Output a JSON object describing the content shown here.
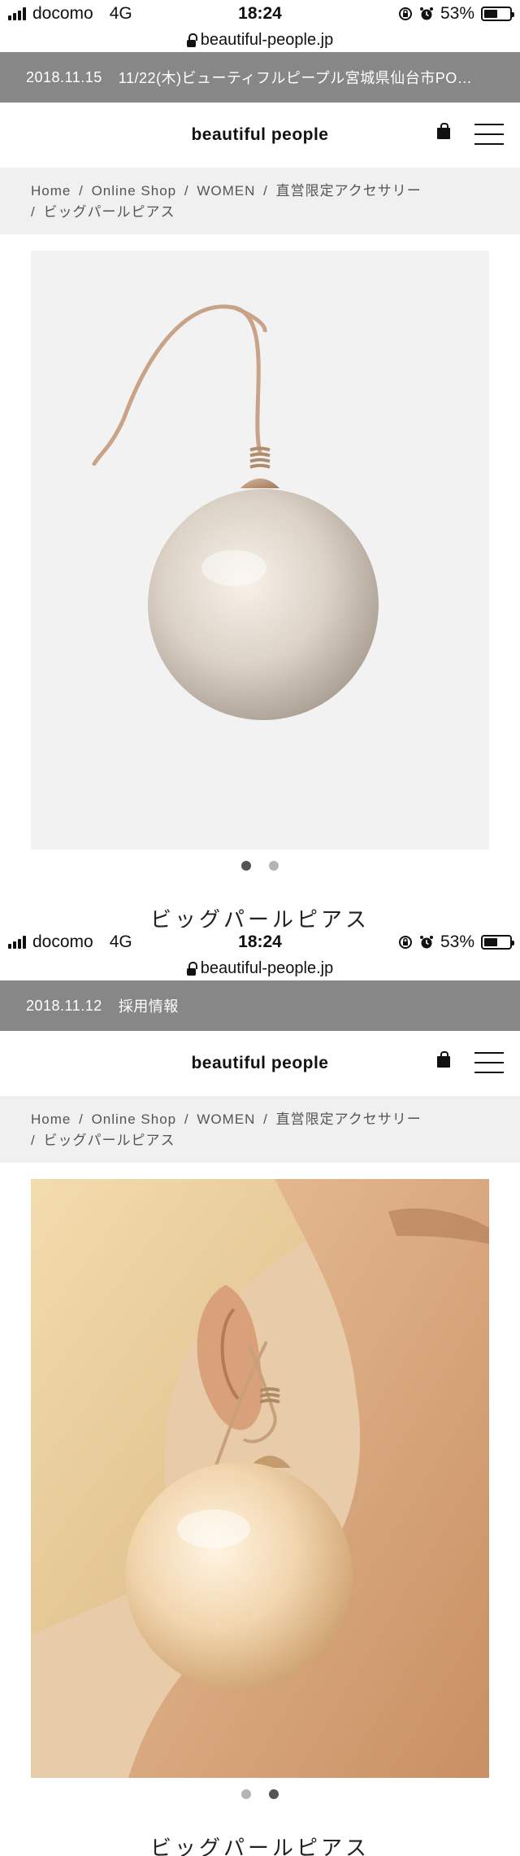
{
  "screens": [
    {
      "status": {
        "carrier": "docomo",
        "network": "4G",
        "time": "18:24",
        "battery": "53%",
        "battery_level": 0.53
      },
      "url": "beautiful-people.jp",
      "ticker": {
        "date": "2018.11.15",
        "text": "11/22(木)ビューティフルピープル宮城県仙台市PO…"
      },
      "logo": "beautiful people",
      "breadcrumb": {
        "home": "Home",
        "shop": "Online Shop",
        "women": "WOMEN",
        "category": "直営限定アクセサリー",
        "current": "ビッグパールピアス",
        "sep": "/"
      },
      "active_slide": 1,
      "product_title": "ビッグパールピアス"
    },
    {
      "status": {
        "carrier": "docomo",
        "network": "4G",
        "time": "18:24",
        "battery": "53%",
        "battery_level": 0.53
      },
      "url": "beautiful-people.jp",
      "ticker": {
        "date": "2018.11.12",
        "text": "採用情報"
      },
      "logo": "beautiful people",
      "breadcrumb": {
        "home": "Home",
        "shop": "Online Shop",
        "women": "WOMEN",
        "category": "直営限定アクセサリー",
        "current": "ビッグパールピアス",
        "sep": "/"
      },
      "active_slide": 2,
      "product_title": "ビッグパールピアス"
    }
  ],
  "icons": {
    "bag": "shopping-bag-icon",
    "menu": "hamburger-menu-icon",
    "lock": "lock-icon",
    "alarm": "alarm-clock-icon",
    "rotation": "rotation-lock-icon"
  },
  "colors": {
    "ticker_bg": "#878787",
    "breadcrumb_bg": "#f0f0f0",
    "dot_active": "#555555",
    "dot_inactive": "#b5b5b5"
  }
}
